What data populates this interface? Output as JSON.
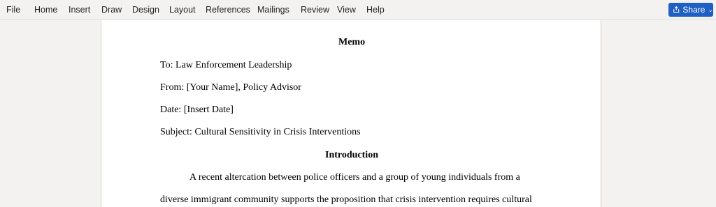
{
  "menu": {
    "items": [
      "File",
      "Home",
      "Insert",
      "Draw",
      "Design",
      "Layout",
      "References",
      "Mailings",
      "Review",
      "View",
      "Help"
    ],
    "share_label": "Share",
    "share_color": "#1f5fc4"
  },
  "document": {
    "title": "Memo",
    "to": "To: Law Enforcement Leadership",
    "from": "From: [Your Name], Policy Advisor",
    "date": "Date: [Insert Date]",
    "subject": "Subject: Cultural Sensitivity in Crisis Interventions",
    "section_heading": "Introduction",
    "paragraph_line1": "A recent altercation between police officers and a group of young individuals from a",
    "paragraph_line2": "diverse immigrant community supports the proposition that crisis intervention requires cultural"
  }
}
